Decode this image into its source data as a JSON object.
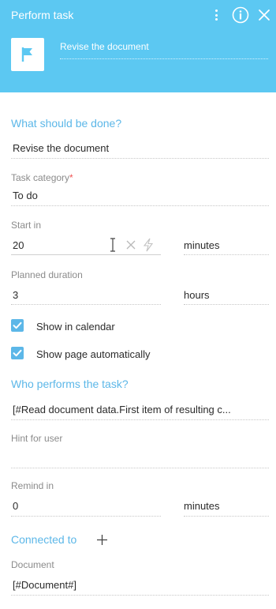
{
  "header": {
    "title": "Perform task",
    "task_name": "Revise the document",
    "icons": [
      "more-icon",
      "info-icon",
      "close-icon",
      "flag-icon"
    ],
    "background_color": "#5cc8f2"
  },
  "what_should_be_done": {
    "section_title": "What should be done?",
    "value": "Revise the document"
  },
  "task_category": {
    "label": "Task category",
    "required_mark": "*",
    "value": "To do"
  },
  "start_in": {
    "label": "Start in",
    "value": "20",
    "unit": "minutes"
  },
  "planned_duration": {
    "label": "Planned duration",
    "value": "3",
    "unit": "hours"
  },
  "checkboxes": {
    "show_in_calendar": {
      "label": "Show in calendar",
      "checked": true
    },
    "show_page_automatically": {
      "label": "Show page automatically",
      "checked": true
    }
  },
  "performer": {
    "section_title": "Who performs the task?",
    "value": "[#Read document data.First item of resulting c..."
  },
  "hint": {
    "label": "Hint for user",
    "value": ""
  },
  "remind_in": {
    "label": "Remind in",
    "value": "0",
    "unit": "minutes"
  },
  "connected_to": {
    "section_title": "Connected to"
  },
  "document": {
    "label": "Document",
    "value": "[#Document#]"
  },
  "accent_color": "#5cb7e8"
}
